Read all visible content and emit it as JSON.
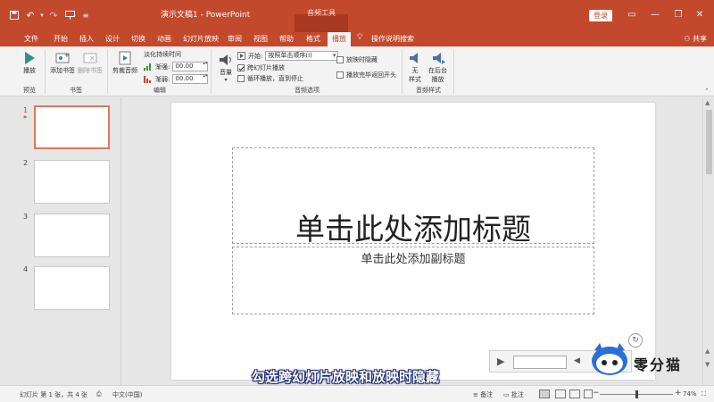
{
  "app": {
    "doc_title": "演示文稿1 - PowerPoint",
    "context_tool": "音频工具",
    "login": "登录",
    "share": "共享"
  },
  "qat": {
    "save_icon": "save-icon",
    "undo_icon": "undo-icon",
    "redo_icon": "redo-icon",
    "present_icon": "present-icon",
    "customize_icon": "customize-icon"
  },
  "tabs": [
    "文件",
    "开始",
    "插入",
    "设计",
    "切换",
    "动画",
    "幻灯片放映",
    "审阅",
    "视图",
    "帮助",
    "格式",
    "播放"
  ],
  "active_tab": "播放",
  "tell_me": "操作说明搜索",
  "ribbon": {
    "preview": {
      "play": "播放",
      "group": "预览"
    },
    "bookmark": {
      "add": "添加书签",
      "remove": "删除书签",
      "group": "书签"
    },
    "edit": {
      "trim": "剪裁音频",
      "fade_title": "淡化持续时间",
      "fade_in_label": "渐强:",
      "fade_in_value": "00.00",
      "fade_out_label": "渐弱:",
      "fade_out_value": "00.00",
      "group": "编辑"
    },
    "audio_options": {
      "volume": "音量",
      "start_label": "开始:",
      "start_value": "按照单击顺序(I)",
      "cross_slides": "跨幻灯片播放",
      "cross_slides_checked": true,
      "loop": "循环播放，直到停止",
      "loop_checked": false,
      "hide": "放映时隐藏",
      "hide_checked": false,
      "rewind": "播放完毕返回开头",
      "rewind_checked": false,
      "group": "音频选项"
    },
    "audio_styles": {
      "no_style_1": "无",
      "no_style_2": "样式",
      "bg_play_1": "在后台",
      "bg_play_2": "播放",
      "group": "音频样式"
    }
  },
  "thumbnails": [
    {
      "num": "1",
      "star": "*"
    },
    {
      "num": "2"
    },
    {
      "num": "3"
    },
    {
      "num": "4"
    }
  ],
  "slide": {
    "title_placeholder": "单击此处添加标题",
    "subtitle_placeholder": "单击此处添加副标题"
  },
  "caption": "勾选跨幻灯片放映和放映时隐藏",
  "watermark": "零分猫",
  "status": {
    "slide_info": "幻灯片 第 1 张，共 4 张",
    "language": "中文(中国)",
    "notes": "备注",
    "comments": "批注",
    "zoom": "74%"
  }
}
